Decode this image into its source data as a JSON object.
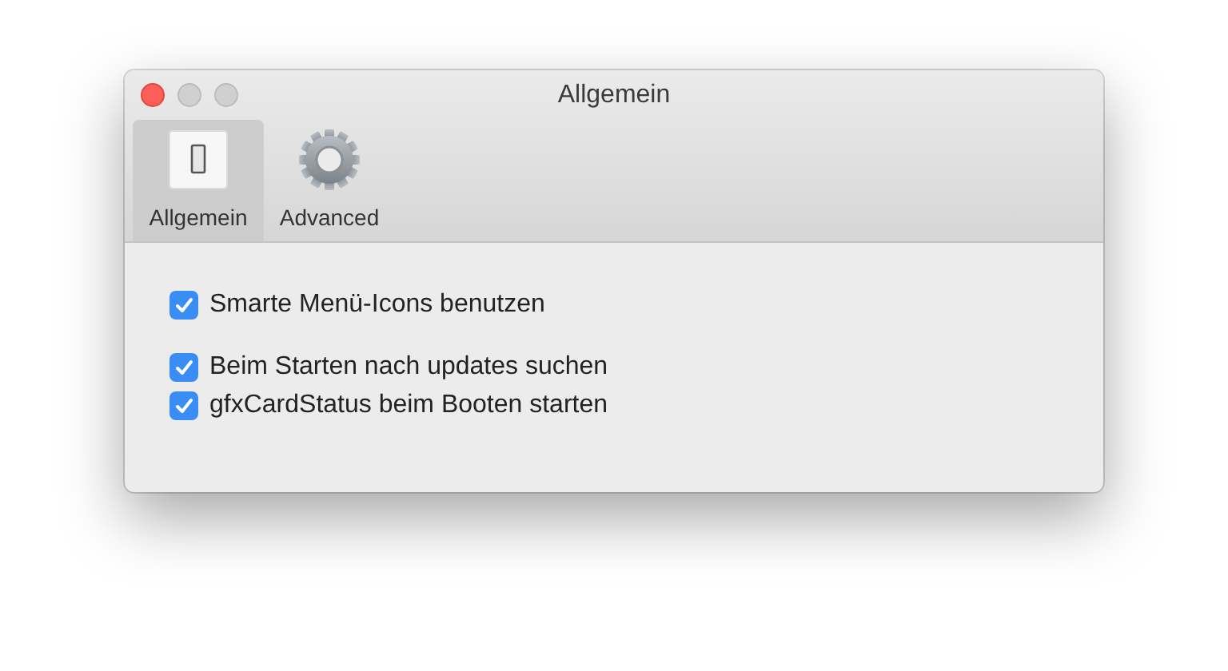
{
  "window": {
    "title": "Allgemein"
  },
  "tabs": [
    {
      "label": "Allgemein",
      "kind": "switch",
      "selected": true
    },
    {
      "label": "Advanced",
      "kind": "gear",
      "selected": false
    }
  ],
  "options": [
    {
      "label": "Smarte Menü-Icons benutzen",
      "checked": true,
      "separated": false
    },
    {
      "label": "Beim Starten nach updates suchen",
      "checked": true,
      "separated": true
    },
    {
      "label": "gfxCardStatus beim Booten starten",
      "checked": true,
      "separated": false
    }
  ]
}
